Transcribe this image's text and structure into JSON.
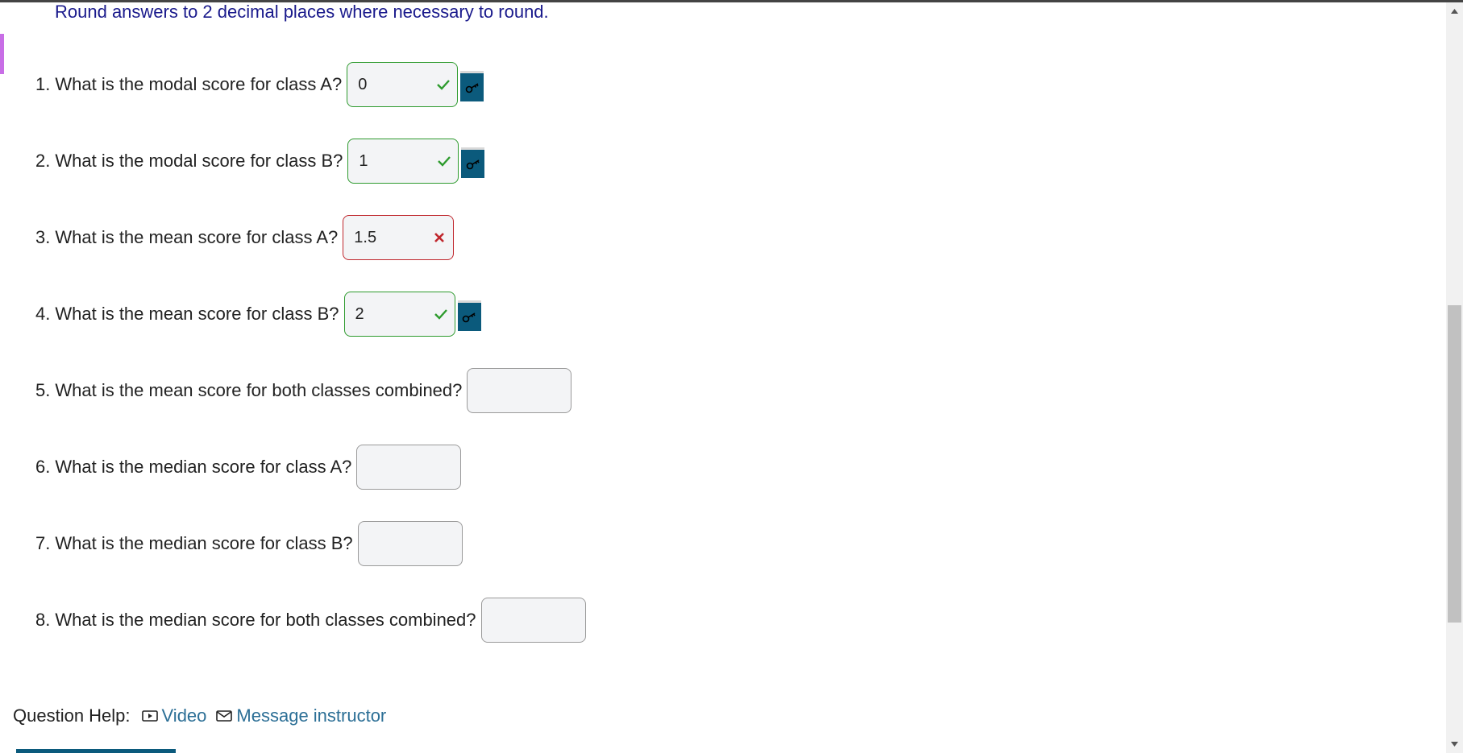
{
  "instructions": "Round answers to 2 decimal places where necessary to round.",
  "questions": [
    {
      "num": "1.",
      "text": "What is the modal score for class A?",
      "value": "0",
      "status": "correct",
      "has_key": true
    },
    {
      "num": "2.",
      "text": "What is the modal score for class B?",
      "value": "1",
      "status": "correct",
      "has_key": true
    },
    {
      "num": "3.",
      "text": "What is the mean score for class A?",
      "value": "1.5",
      "status": "incorrect",
      "has_key": false
    },
    {
      "num": "4.",
      "text": "What is the mean score for class B?",
      "value": "2",
      "status": "correct",
      "has_key": true
    },
    {
      "num": "5.",
      "text": "What is the mean score for both classes combined?",
      "value": "",
      "status": "empty",
      "has_key": false
    },
    {
      "num": "6.",
      "text": "What is the median score for class A?",
      "value": "",
      "status": "empty",
      "has_key": false
    },
    {
      "num": "7.",
      "text": "What is the median score for class B?",
      "value": "",
      "status": "empty",
      "has_key": false
    },
    {
      "num": "8.",
      "text": "What is the median score for both classes combined?",
      "value": "",
      "status": "empty",
      "has_key": false
    }
  ],
  "help": {
    "label": "Question Help:",
    "video_label": "Video",
    "message_label": "Message instructor"
  },
  "icons": {
    "correct": "check-icon",
    "incorrect": "x-icon",
    "key": "key-icon",
    "video": "video-icon",
    "message": "mail-icon"
  },
  "colors": {
    "correct": "#2e9b2e",
    "incorrect": "#c0272d",
    "key_button": "#0b5a7c",
    "link": "#2c6f96",
    "instructions": "#1a1a8c"
  }
}
